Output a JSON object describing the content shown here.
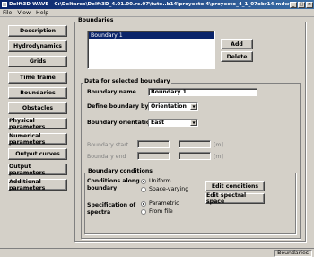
{
  "window": {
    "title": "Delft3D-WAVE - C:\\Deltares\\Delft3D_4.01.00.rc.07\\tuto..b14\\proyecto 4\\proyecto_4_1_07obr14.mdw",
    "min_label": "_",
    "max_label": "□",
    "close_label": "×"
  },
  "menu": {
    "items": [
      "File",
      "View",
      "Help"
    ]
  },
  "nav": {
    "items": [
      "Description",
      "Hydrodynamics",
      "Grids",
      "Time frame",
      "Boundaries",
      "Obstacles",
      "Physical parameters",
      "Numerical parameters",
      "Output curves",
      "Output parameters",
      "Additional parameters"
    ]
  },
  "boundaries": {
    "group_label": "Boundaries",
    "list": [
      "Boundary 1"
    ],
    "add_label": "Add",
    "delete_label": "Delete"
  },
  "selected": {
    "group_label": "Data for selected boundary",
    "name_label": "Boundary name",
    "name_value": "Boundary 1",
    "define_label": "Define boundary by",
    "define_value": "Orientation",
    "orientation_label": "Boundary orientation",
    "orientation_value": "East",
    "start_label": "Boundary start",
    "end_label": "Boundary end",
    "unit": "[m]"
  },
  "conditions": {
    "group_label": "Boundary conditions",
    "along_label_1": "Conditions along",
    "along_label_2": "boundary",
    "uniform_label": "Uniform",
    "varying_label": "Space-varying",
    "spec_label_1": "Specification of",
    "spec_label_2": "spectra",
    "parametric_label": "Parametric",
    "fromfile_label": "From file",
    "edit_conditions_label": "Edit conditions",
    "edit_spectral_label": "Edit spectral space"
  },
  "status": {
    "text": "Boundaries"
  }
}
